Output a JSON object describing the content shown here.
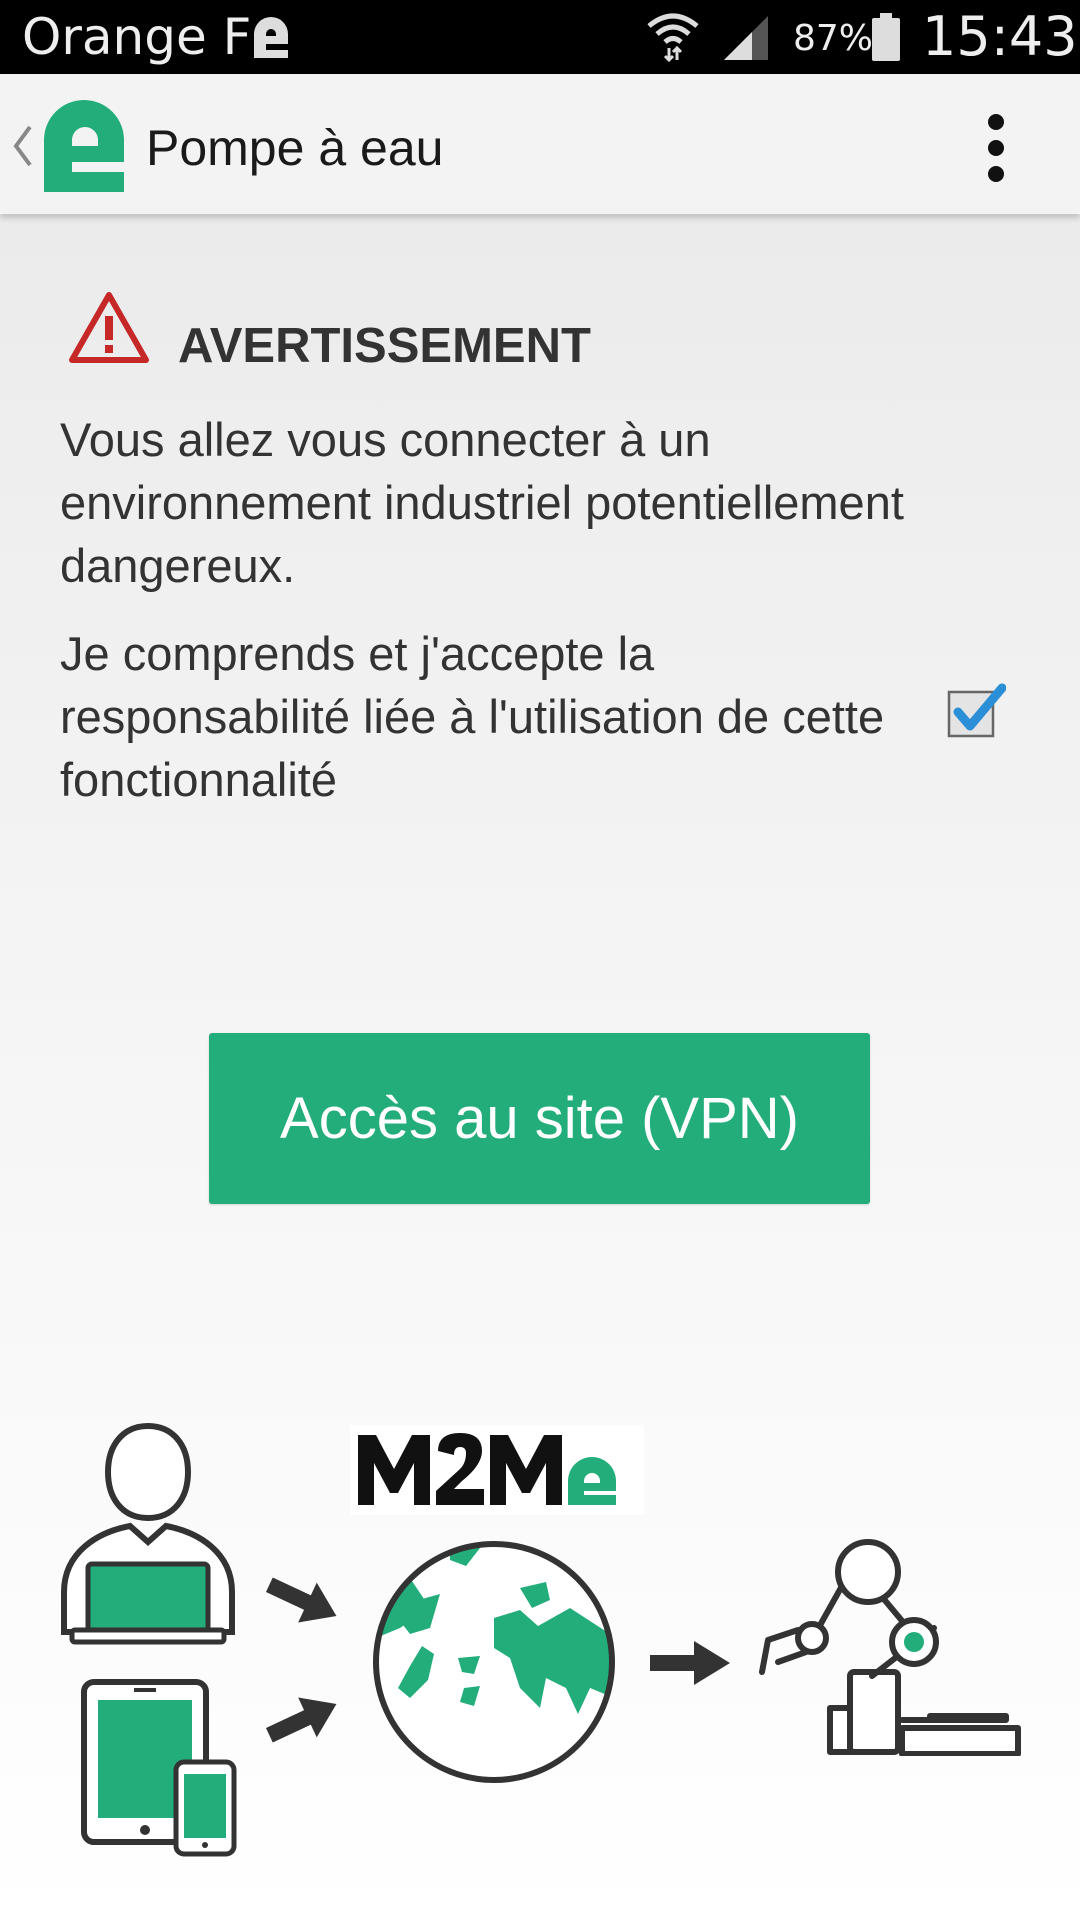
{
  "status_bar": {
    "carrier": "Orange F",
    "battery_percent": "87%",
    "time": "15:43",
    "icons": [
      "carrier-app-icon",
      "wifi-icon",
      "signal-icon",
      "battery-icon"
    ]
  },
  "app_bar": {
    "title": "Pompe à eau",
    "icons": [
      "back-chevron-icon",
      "app-logo-icon",
      "overflow-menu-icon"
    ]
  },
  "warning": {
    "icon": "warning-triangle-icon",
    "title": "AVERTISSEMENT",
    "message": "Vous allez vous connecter à un environnement industriel potentiellement dangereux.",
    "accept_label": "Je comprends et j'accepte la responsabilité liée à l'utilisation de cette fonctionnalité",
    "accepted": true
  },
  "action": {
    "vpn_button_label": "Accès au site (VPN)"
  },
  "illustration": {
    "brand": "M2Me",
    "items": [
      "user-laptop-icon",
      "tablet-phone-icon",
      "arrow-icon",
      "globe-icon",
      "arrow-icon",
      "robot-arm-icon"
    ]
  },
  "colors": {
    "accent": "#23ad7a",
    "warning_red": "#c62828",
    "checkbox_blue": "#2a8fd6",
    "status_bar_bg": "#000000",
    "app_bar_bg": "#f3f3f3"
  }
}
